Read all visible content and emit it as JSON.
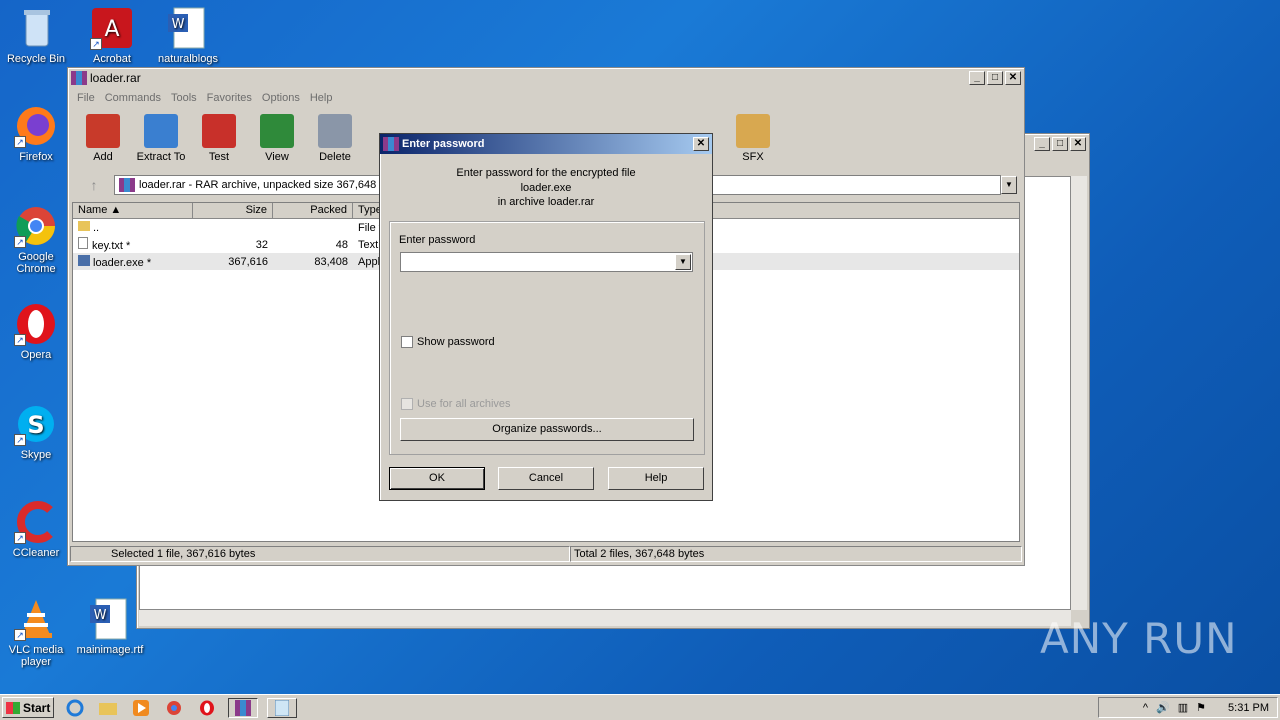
{
  "desktop": {
    "icons": [
      {
        "label": "Recycle Bin",
        "icon": "recycle-bin-icon"
      },
      {
        "label": "Acrobat",
        "icon": "acrobat-icon"
      },
      {
        "label": "naturalblogs",
        "icon": "word-doc-icon"
      },
      {
        "label": "Firefox",
        "icon": "firefox-icon"
      },
      {
        "label": "Google Chrome",
        "icon": "chrome-icon"
      },
      {
        "label": "Opera",
        "icon": "opera-icon"
      },
      {
        "label": "Skype",
        "icon": "skype-icon"
      },
      {
        "label": "CCleaner",
        "icon": "ccleaner-icon"
      },
      {
        "label": "VLC media player",
        "icon": "vlc-icon"
      },
      {
        "label": "mainimage.rtf",
        "icon": "word-doc-icon"
      }
    ],
    "watermark": "ANY RUN"
  },
  "winrar": {
    "title": "loader.rar",
    "menu": [
      "File",
      "Commands",
      "Tools",
      "Favorites",
      "Options",
      "Help"
    ],
    "toolbar": [
      {
        "label": "Add",
        "color": "#c83a2a"
      },
      {
        "label": "Extract To",
        "color": "#3a7fd0"
      },
      {
        "label": "Test",
        "color": "#c8302a"
      },
      {
        "label": "View",
        "color": "#2f8a3a"
      },
      {
        "label": "Delete",
        "color": "#8a96a8"
      }
    ],
    "toolbar_sfx": "SFX",
    "address": "loader.rar - RAR archive, unpacked size 367,648",
    "columns": [
      "Name",
      "Size",
      "Packed",
      "Type"
    ],
    "files": [
      {
        "name": "..",
        "size": "",
        "packed": "",
        "type": "File f"
      },
      {
        "name": "key.txt *",
        "size": "32",
        "packed": "48",
        "type": "Text"
      },
      {
        "name": "loader.exe *",
        "size": "367,616",
        "packed": "83,408",
        "type": "Appl"
      }
    ],
    "status_left": "Selected 1 file, 367,616 bytes",
    "status_right": "Total 2 files, 367,648 bytes"
  },
  "dialog": {
    "title": "Enter password",
    "message_line1": "Enter password for the encrypted file",
    "message_line2": "loader.exe",
    "message_line3": "in archive loader.rar",
    "field_label": "Enter password",
    "password_value": "",
    "show_password": "Show password",
    "use_for_all": "Use for all archives",
    "organize": "Organize passwords...",
    "ok": "OK",
    "cancel": "Cancel",
    "help": "Help"
  },
  "taskbar": {
    "start": "Start",
    "clock": "5:31 PM"
  }
}
